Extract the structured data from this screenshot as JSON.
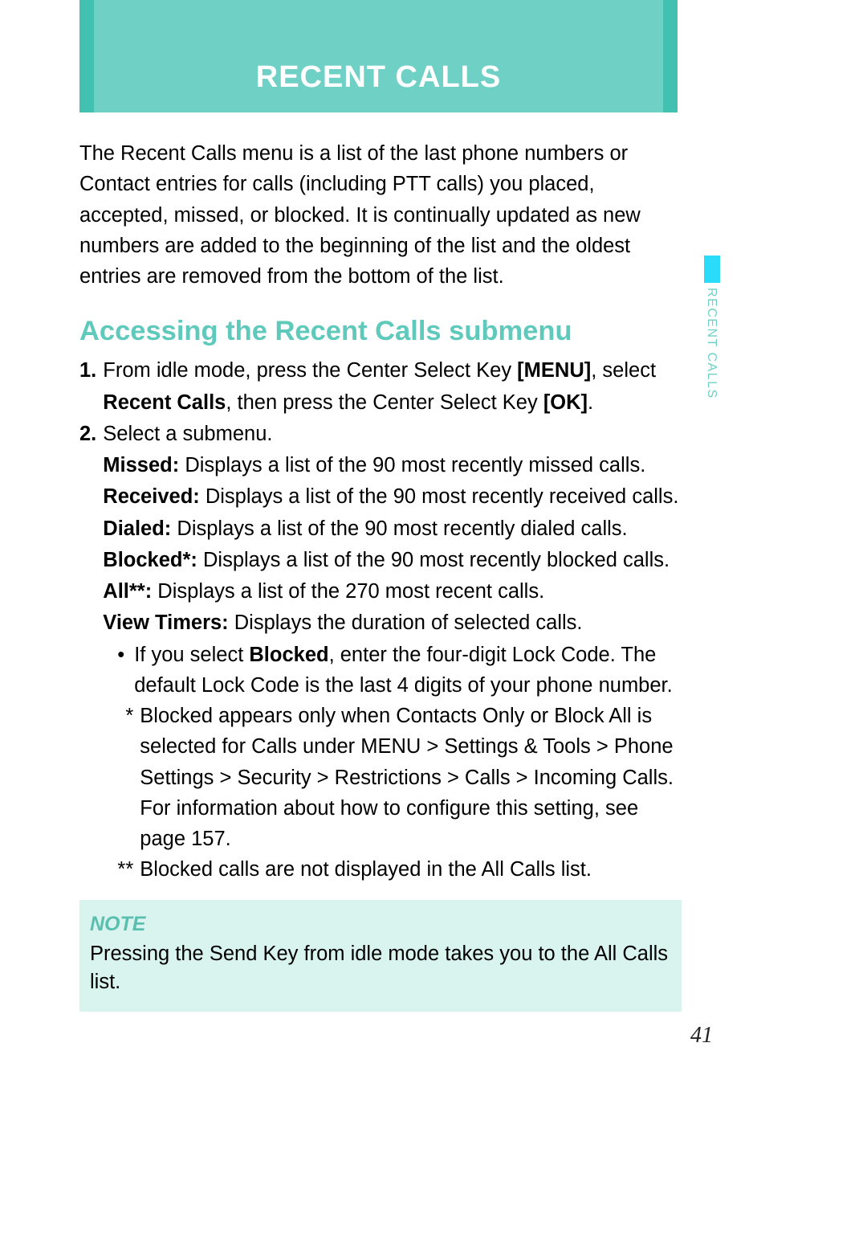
{
  "header": {
    "title": "RECENT CALLS"
  },
  "side_tab": "RECENT CALLS",
  "intro": "The Recent Calls menu is a list of the last phone numbers or Contact entries for calls (including PTT calls) you placed, accepted, missed, or blocked. It is continually updated as new numbers are added to the beginning of the list and the oldest entries are removed from the bottom of the list.",
  "section_heading": "Accessing the Recent Calls submenu",
  "steps": [
    {
      "num": "1.",
      "lines": [
        {
          "pre": "From idle mode, press the Center Select Key ",
          "bold": "[MENU]",
          "post": ", select"
        },
        {
          "pre": "",
          "bold": "Recent Calls",
          "post": ", then press the Center Select Key ",
          "bold2": "[OK]",
          "post2": "."
        }
      ]
    },
    {
      "num": "2.",
      "intro": "Select a submenu.",
      "submenu": [
        {
          "label": "Missed:",
          "desc": " Displays a list of the 90 most recently missed calls."
        },
        {
          "label": "Received:",
          "desc": " Displays a list of the 90 most recently received calls."
        },
        {
          "label": "Dialed:",
          "desc": " Displays a list of the 90 most recently dialed calls."
        },
        {
          "label": "Blocked*:",
          "desc": " Displays a list of the 90 most recently blocked calls."
        },
        {
          "label": "All**:",
          "desc": " Displays a list of the 270 most recent calls."
        },
        {
          "label": "View Timers:",
          "desc": " Displays the duration of selected calls."
        }
      ],
      "bullet": {
        "pre": "If you select ",
        "bold": "Blocked",
        "post": ", enter the four-digit Lock Code. The default Lock Code is the last 4 digits of your phone number."
      },
      "footnotes": [
        {
          "marker": "*",
          "text": "Blocked appears only when Contacts Only or Block All is selected for Calls under MENU > Settings & Tools > Phone Settings > Security > Restrictions > Calls > Incoming Calls. For information about how to configure this setting, see page 157."
        },
        {
          "marker": "**",
          "text": "Blocked calls are not displayed in the All Calls list."
        }
      ]
    }
  ],
  "note": {
    "label": "NOTE",
    "text": "Pressing the Send Key from idle mode takes you to the All Calls list."
  },
  "page_number": "41"
}
